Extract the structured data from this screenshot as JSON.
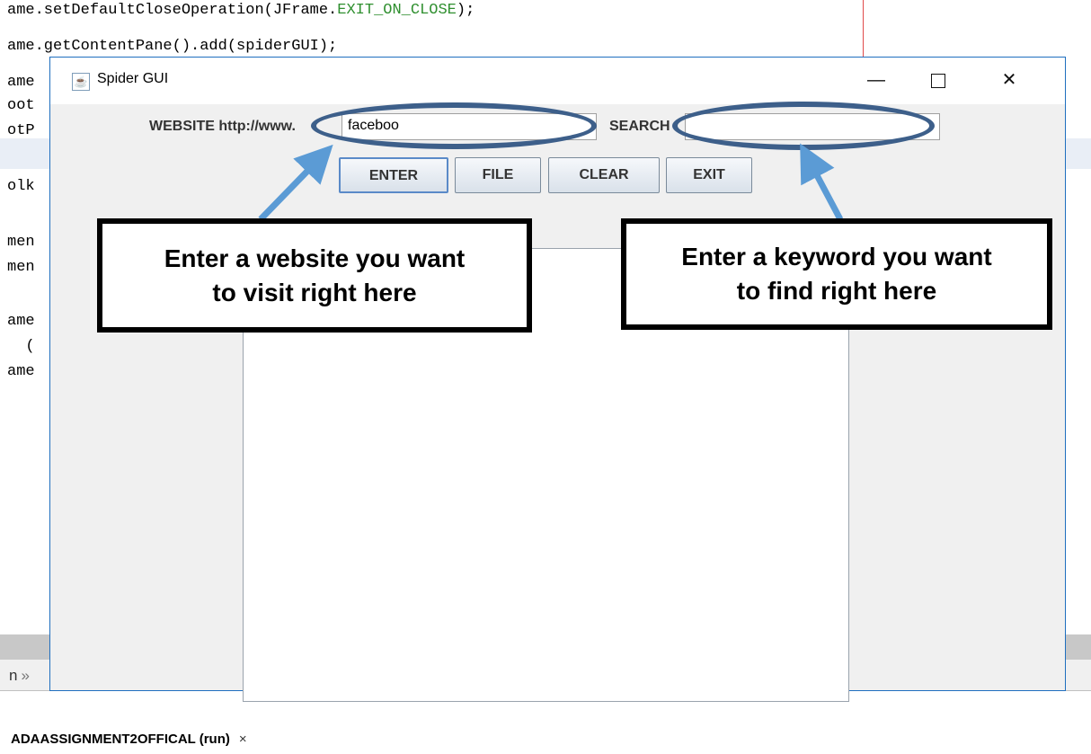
{
  "ide": {
    "code_lines": [
      {
        "text": "ame.setDefaultCloseOperation(JFrame.",
        "tail": "EXIT_ON_CLOSE",
        "end": ");"
      },
      {
        "text": "ame.getContentPane().add(spiderGUI);",
        "tail": "",
        "end": ""
      },
      {
        "text": "ame",
        "tail": "",
        "end": ""
      },
      {
        "text": "oot",
        "tail": "",
        "end": ""
      },
      {
        "text": "otP",
        "tail": "",
        "end": ""
      },
      {
        "text": "olk",
        "tail": "",
        "end": ""
      },
      {
        "text": "men",
        "tail": "",
        "end": ""
      },
      {
        "text": "men",
        "tail": "",
        "end": ""
      },
      {
        "text": "ame",
        "tail": "",
        "end": ""
      },
      {
        "text": "  (",
        "tail": "",
        "end": ""
      },
      {
        "text": "ame",
        "tail": "",
        "end": ""
      }
    ],
    "output_prefix": "n",
    "output_chevron_icon": "double-chevron-right",
    "run_tab_label": "ADAASSIGNMENT2OFFICAL (run)",
    "run_tab_close": "×"
  },
  "window": {
    "title": "Spider GUI",
    "app_icon": "java-cup-icon",
    "minimize_glyph": "—",
    "close_glyph": "✕"
  },
  "form": {
    "website_label": "WEBSITE http://www.",
    "website_value": "faceboo",
    "search_label": "SEARCH",
    "search_value": ""
  },
  "buttons": {
    "enter": "ENTER",
    "file": "FILE",
    "clear": "CLEAR",
    "exit": "EXIT"
  },
  "annotations": {
    "left_callout": [
      "Enter a website you want",
      "to visit right here"
    ],
    "right_callout": [
      "Enter a keyword you want",
      "to find right here"
    ],
    "oval_color": "#3d5f8a",
    "arrow_color": "#5b9bd5"
  }
}
